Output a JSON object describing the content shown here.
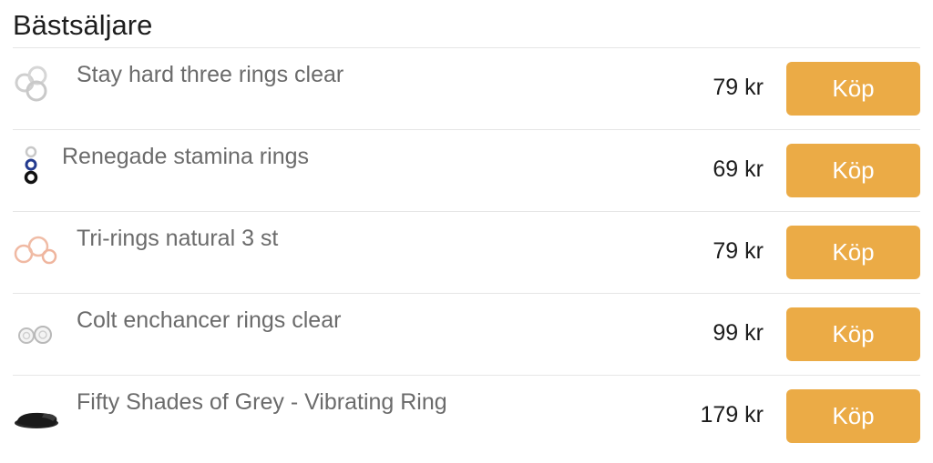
{
  "section": {
    "title": "Bästsäljare"
  },
  "products": [
    {
      "name": "Stay hard three rings clear",
      "price": "79 kr",
      "buy_label": "Köp",
      "icon": "clear-rings-icon"
    },
    {
      "name": "Renegade stamina rings",
      "price": "69 kr",
      "buy_label": "Köp",
      "icon": "stamina-rings-icon"
    },
    {
      "name": "Tri-rings natural 3 st",
      "price": "79 kr",
      "buy_label": "Köp",
      "icon": "natural-rings-icon"
    },
    {
      "name": "Colt enchancer rings clear",
      "price": "99 kr",
      "buy_label": "Köp",
      "icon": "enhancer-rings-icon"
    },
    {
      "name": "Fifty Shades of Grey - Vibrating Ring",
      "price": "179 kr",
      "buy_label": "Köp",
      "icon": "vibrating-ring-icon"
    }
  ],
  "colors": {
    "button_bg": "#ebab46",
    "button_text": "#ffffff",
    "product_name": "#6b6b6b",
    "price": "#1c1c1c",
    "divider": "#e6e6e6"
  }
}
